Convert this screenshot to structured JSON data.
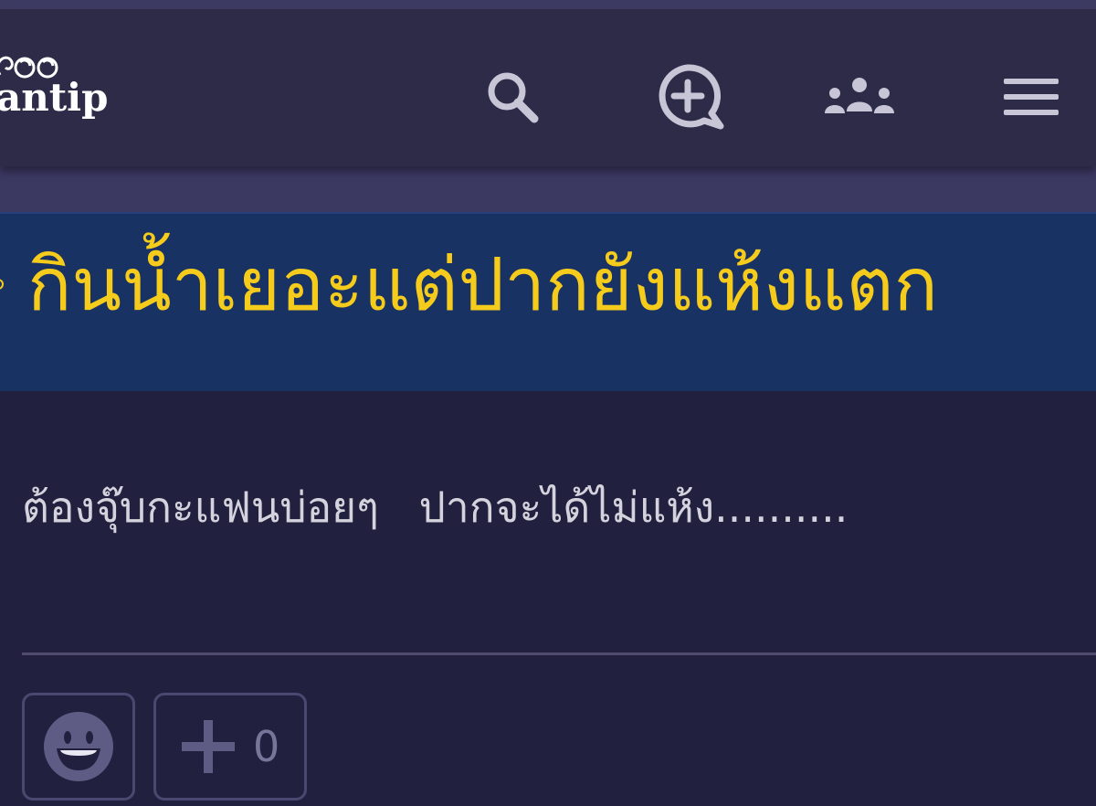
{
  "header": {
    "logo_text": "antip",
    "icons": {
      "search": "search-icon",
      "new_topic": "add-topic-icon",
      "community": "group-icon",
      "menu": "menu-icon"
    }
  },
  "topic": {
    "title": "กินน้ำเยอะแต่ปากยังแห้งแตก"
  },
  "reply": {
    "text": "ต้องจุ๊บกะแฟนบ่อยๆ   ปากจะได้ไม่แห้ง..........",
    "vote_count": "0"
  },
  "colors": {
    "header_bg": "#2d2b48",
    "banner_bg": "#193264",
    "title_color": "#f6cc1c",
    "page_bg": "#21213f"
  }
}
